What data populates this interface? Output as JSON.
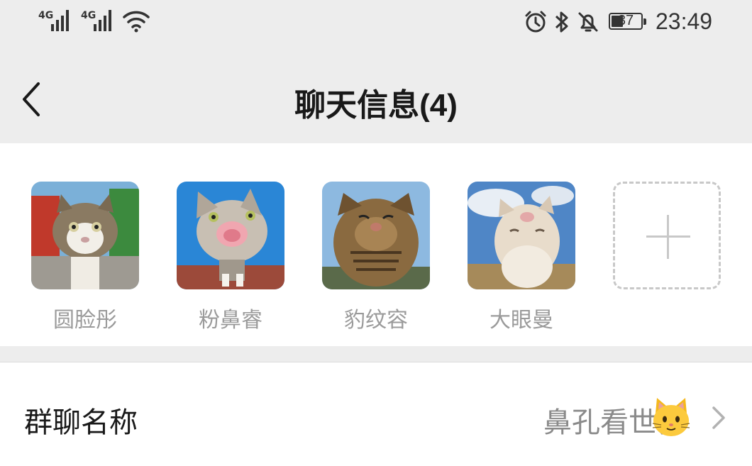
{
  "status_bar": {
    "signal1_label": "4G",
    "signal2_label": "4G",
    "battery": "37",
    "time": "23:49",
    "icons": [
      "signal-icon",
      "signal-icon",
      "wifi-icon",
      "alarm-icon",
      "bluetooth-icon",
      "bell-off-icon",
      "battery-icon"
    ]
  },
  "nav": {
    "title": "聊天信息(4)",
    "back_icon": "chevron-left-icon"
  },
  "members": [
    {
      "name": "圆脸彤"
    },
    {
      "name": "粉鼻睿"
    },
    {
      "name": "豹纹容"
    },
    {
      "name": "大眼曼"
    }
  ],
  "add_member_icon": "plus-icon",
  "group_name": {
    "label": "群聊名称",
    "value": "鼻孔看世界",
    "emoji_icon": "cat-face-icon",
    "chevron_icon": "chevron-right-icon"
  },
  "colors": {
    "background": "#ededed",
    "panel": "#ffffff",
    "secondary_text": "#9a9a9a",
    "value_text": "#8a8a8a"
  }
}
